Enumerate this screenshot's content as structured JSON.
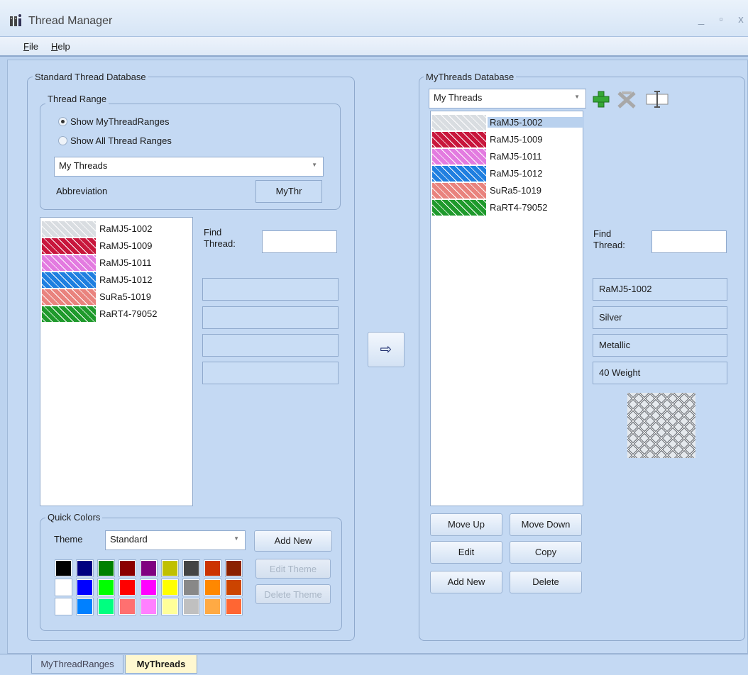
{
  "window": {
    "title": "Thread Manager",
    "controls": [
      "_",
      "▫",
      "x"
    ]
  },
  "menu": [
    {
      "label": "File",
      "accel": "F",
      "rest": "ile"
    },
    {
      "label": "Help",
      "accel": "H",
      "rest": "elp"
    }
  ],
  "standard": {
    "group_title": "Standard Thread Database",
    "thread_range": {
      "group_title": "Thread Range",
      "option_my": "Show MyThreadRanges",
      "option_all": "Show All Thread Ranges",
      "selected_option": "my",
      "range_value": "My Threads",
      "abbreviation_label": "Abbreviation",
      "abbreviation_value": "MyThr"
    },
    "threads": [
      {
        "name": "RaMJ5-1002",
        "color": "#d9dde1"
      },
      {
        "name": "RaMJ5-1009",
        "color": "#c8163c"
      },
      {
        "name": "RaMJ5-1011",
        "color": "#e37be0"
      },
      {
        "name": "RaMJ5-1012",
        "color": "#1f7fe0"
      },
      {
        "name": "SuRa5-1019",
        "color": "#e9837e"
      },
      {
        "name": "RaRT4-79052",
        "color": "#1f9a2c"
      }
    ],
    "find_label": "Find Thread:",
    "find_value": "",
    "detail_fields": [
      "",
      "",
      "",
      ""
    ]
  },
  "transfer_button": "⇨",
  "quick_colors": {
    "group_title": "Quick Colors",
    "theme_label": "Theme",
    "theme_value": "Standard",
    "add_new": "Add New",
    "edit_theme": "Edit Theme",
    "delete_theme": "Delete Theme",
    "palette": [
      [
        "#000000",
        "#000080",
        "#008000",
        "#8b0000",
        "#800080",
        "#c0c000",
        "#444444",
        "#cc3300",
        "#8b2200"
      ],
      [
        "#ffffff",
        "#0000ff",
        "#00ff00",
        "#ff0000",
        "#ff00ff",
        "#ffff00",
        "#888888",
        "#ff8800",
        "#cc4400"
      ],
      [
        "#ffffff",
        "#0080ff",
        "#00ff80",
        "#ff7070",
        "#ff80ff",
        "#ffff99",
        "#c0c0c0",
        "#ffaa44",
        "#ff6633"
      ]
    ]
  },
  "mythreads": {
    "group_title": "MyThreads Database",
    "range_value": "My Threads",
    "toolbar": {
      "add": "add-icon",
      "delete": "delete-icon",
      "rename": "rename-icon"
    },
    "threads": [
      {
        "name": "RaMJ5-1002",
        "color": "#d9dde1",
        "selected": true
      },
      {
        "name": "RaMJ5-1009",
        "color": "#c8163c"
      },
      {
        "name": "RaMJ5-1011",
        "color": "#e37be0"
      },
      {
        "name": "RaMJ5-1012",
        "color": "#1f7fe0"
      },
      {
        "name": "SuRa5-1019",
        "color": "#e9837e"
      },
      {
        "name": "RaRT4-79052",
        "color": "#1f9a2c"
      }
    ],
    "find_label": "Find Thread:",
    "find_value": "",
    "details": [
      "RaMJ5-1002",
      "Silver",
      "Metallic",
      "40 Weight"
    ],
    "buttons": {
      "move_up": "Move Up",
      "move_down": "Move Down",
      "edit": "Edit",
      "copy": "Copy",
      "add_new": "Add New",
      "delete": "Delete"
    }
  },
  "tabs": [
    {
      "label": "MyThreadRanges",
      "active": false
    },
    {
      "label": "MyThreads",
      "active": true
    }
  ]
}
